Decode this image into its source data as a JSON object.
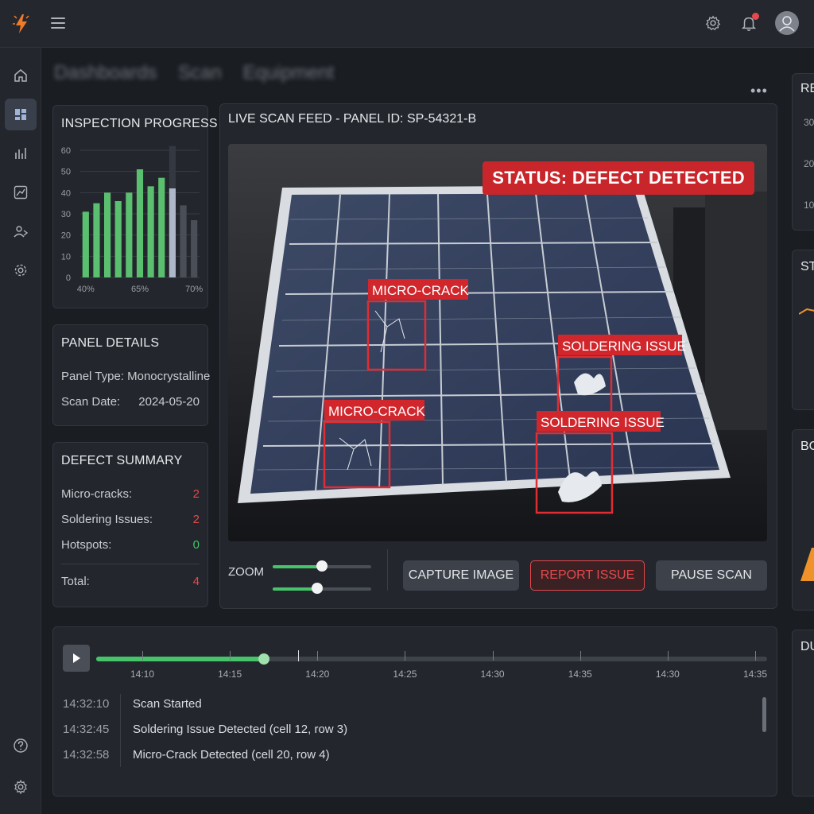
{
  "topbar": {
    "icons": [
      "lightning-logo-icon",
      "hamburger-menu-icon",
      "gear-icon",
      "bell-icon",
      "user-avatar-icon"
    ],
    "notification_dot_color": "#e5484d"
  },
  "sidebar": {
    "items": [
      {
        "icon": "home-icon"
      },
      {
        "icon": "dashboard-icon",
        "active": true
      },
      {
        "icon": "bar-chart-icon"
      },
      {
        "icon": "line-chart-icon"
      },
      {
        "icon": "users-icon"
      },
      {
        "icon": "settings-icon"
      }
    ],
    "bottom_items": [
      {
        "icon": "help-icon"
      },
      {
        "icon": "gear-icon"
      }
    ]
  },
  "breadcrumb": [
    "Dashboards",
    "Scan",
    "Equipment"
  ],
  "progress": {
    "title": "INSPECTION PROGRESS",
    "y_ticks": [
      "60",
      "50",
      "40",
      "30",
      "20",
      "10",
      "0"
    ],
    "x_labels": [
      "40%",
      "65%",
      "70%"
    ]
  },
  "chart_data": {
    "type": "bar",
    "title": "INSPECTION PROGRESS",
    "xlabel": "",
    "ylabel": "",
    "ylim": [
      0,
      60
    ],
    "categories": [
      "40%",
      "",
      "",
      "",
      "",
      "65%",
      "",
      "",
      "",
      "",
      "70%"
    ],
    "series": [
      {
        "values": [
          31,
          35,
          40,
          36,
          40,
          51,
          43,
          47,
          null,
          null,
          null
        ]
      },
      {
        "values": [
          null,
          null,
          null,
          null,
          null,
          null,
          null,
          null,
          42,
          34,
          27
        ]
      }
    ],
    "series_colors": [
      "#5bbf70",
      "#4a4f57"
    ],
    "highlight": {
      "index": 8,
      "value": 42,
      "background_value": 62,
      "color": "#aeb7c8"
    },
    "grid": true
  },
  "panel_details": {
    "title": "PANEL DETAILS",
    "rows": [
      {
        "label": "Panel Type:",
        "value": "Monocrystalline"
      },
      {
        "label": "Scan Date:",
        "value": "2024-05-20"
      }
    ]
  },
  "defect_summary": {
    "title": "DEFECT SUMMARY",
    "rows": [
      {
        "label": "Micro-cracks:",
        "value": "2"
      },
      {
        "label": "Soldering Issues:",
        "value": "2"
      },
      {
        "label": "Hotspots:",
        "value": "0"
      }
    ],
    "total": {
      "label": "Total:",
      "value": "4"
    }
  },
  "feed": {
    "title": "LIVE SCAN FEED - PANEL ID: SP-54321-B",
    "more_icon": "more-horizontal-icon",
    "status": "STATUS: DEFECT DETECTED",
    "annotations": [
      {
        "label": "MICRO-CRACK"
      },
      {
        "label": "SOLDERING ISSUE"
      },
      {
        "label": "MICRO-CRACK"
      },
      {
        "label": "SOLDERING ISSUE"
      }
    ],
    "zoom_label": "ZOOM",
    "zoom_values": [
      0.5,
      0.45
    ],
    "buttons": {
      "capture": "CAPTURE IMAGE",
      "report": "REPORT ISSUE",
      "pause": "PAUSE SCAN"
    }
  },
  "timeline": {
    "play_icon": "play-icon",
    "progress": 0.25,
    "ticks": [
      "14:10",
      "14:15",
      "14:20",
      "14:25",
      "14:30",
      "14:35",
      "14:30",
      "14:35"
    ],
    "log": [
      {
        "time": "14:32:10",
        "text": "Scan Started"
      },
      {
        "time": "14:32:45",
        "text": "Soldering Issue Detected (cell 12, row 3)"
      },
      {
        "time": "14:32:58",
        "text": "Micro-Crack Detected (cell 20, row 4)"
      }
    ]
  },
  "right_column": {
    "card1": {
      "title": "RE",
      "ticks": [
        "30",
        "20",
        "10"
      ]
    },
    "card2": {
      "title": "ST"
    },
    "card3": {
      "title": "BO"
    },
    "card4": {
      "title": "DU"
    }
  }
}
